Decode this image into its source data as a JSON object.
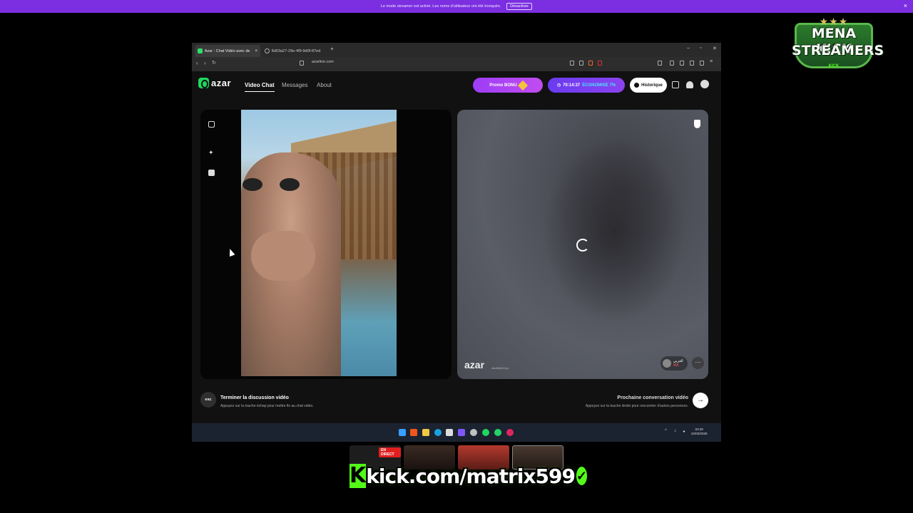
{
  "banner": {
    "message": "Le mode streamer est activé. Les noms d'utilisateur ont été tronqués.",
    "button_label": "Désactiver",
    "close": "×"
  },
  "overlay_logo": {
    "stars": "★★★",
    "line1": "MENA KICK",
    "line2": "STREAMERS",
    "badge": "KICK"
  },
  "browser": {
    "tabs": [
      {
        "label": "Azar : Chat Vidéo avec de no",
        "active": true
      },
      {
        "label": "8d03a27-29e-4f9-9d0f-87ed",
        "active": false
      }
    ],
    "new_tab": "+",
    "window_controls": [
      "–",
      "▫",
      "✕"
    ],
    "url": "azarlive.com"
  },
  "azar": {
    "logo_text": "azar",
    "nav": [
      {
        "label": "Video Chat",
        "active": true
      },
      {
        "label": "Messages",
        "active": false
      },
      {
        "label": "About",
        "active": false
      }
    ],
    "promo_label": "Promo BONU",
    "timer": "70:14:37",
    "economy": "ÉCONOMISE 7%",
    "history_label": "Historique",
    "remote_watermark": "azar",
    "remote_id": "mlu846412yu",
    "remote_user_name": "العربي",
    "remote_user_country": "MA",
    "more": "···",
    "end_key": "esc",
    "end_title": "Terminer la discussion vidéo",
    "end_subtitle": "Appuyez sur la touche échap pour mettre fin au chat vidéo.",
    "next_title": "Prochaine conversation vidéo",
    "next_subtitle": "Appuyez sur la touche droite pour rencontrer d'autres personnes.",
    "next_arrow": "→"
  },
  "taskbar": {
    "time": "03:30",
    "date": "22/03/2026"
  },
  "stream": {
    "live_badge": "EN DIRECT",
    "kick_letter": "K",
    "kick_url": "kick.com/matrix599",
    "verified": "✓"
  },
  "colors": {
    "banner": "#7b2fe0",
    "azar_green": "#1ed760",
    "kick_green": "#53fc18",
    "promo_purple": "#9d3df5"
  }
}
